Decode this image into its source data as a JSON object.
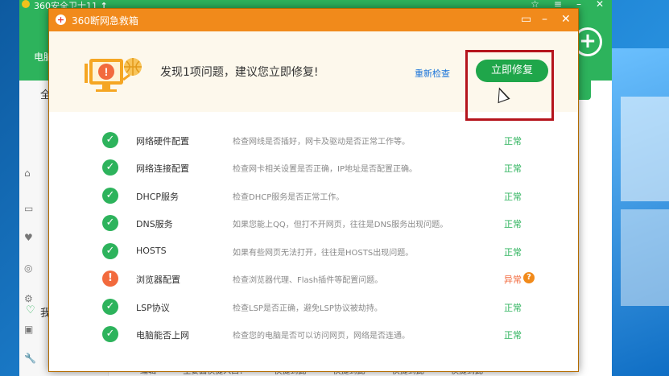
{
  "background_app": {
    "title": "360安全卫士11",
    "title_suffix": "↑",
    "computer_label": "电脑",
    "all_label": "全",
    "my_label": "我",
    "bottom_links": [
      "编辑",
      "主要面快捷入口：",
      "快捷到此",
      "快捷到此",
      "快捷到此",
      "快捷到此"
    ]
  },
  "dialog": {
    "title": "360断网急救箱",
    "headline": "发现1项问题，建议您立即修复!",
    "recheck_label": "重新检查",
    "fix_button_label": "立即修复",
    "items": [
      {
        "name": "网络硬件配置",
        "desc": "检查网线是否插好，网卡及驱动是否正常工作等。",
        "status": "正常",
        "state": "ok"
      },
      {
        "name": "网络连接配置",
        "desc": "检查网卡相关设置是否正确，IP地址是否配置正确。",
        "status": "正常",
        "state": "ok"
      },
      {
        "name": "DHCP服务",
        "desc": "检查DHCP服务是否正常工作。",
        "status": "正常",
        "state": "ok"
      },
      {
        "name": "DNS服务",
        "desc": "如果您能上QQ，但打不开网页，往往是DNS服务出现问题。",
        "status": "正常",
        "state": "ok"
      },
      {
        "name": "HOSTS",
        "desc": "如果有些网页无法打开，往往是HOSTS出现问题。",
        "status": "正常",
        "state": "ok"
      },
      {
        "name": "浏览器配置",
        "desc": "检查浏览器代理、Flash插件等配置问题。",
        "status": "异常",
        "state": "bad"
      },
      {
        "name": "LSP协议",
        "desc": "检查LSP是否正确，避免LSP协议被劫持。",
        "status": "正常",
        "state": "ok"
      },
      {
        "name": "电脑能否上网",
        "desc": "检查您的电脑是否可以访问网页，网络是否连通。",
        "status": "正常",
        "state": "ok"
      }
    ]
  },
  "colors": {
    "accent_orange": "#f18a1b",
    "ok_green": "#2db35c",
    "alert_red": "#b5141c"
  }
}
